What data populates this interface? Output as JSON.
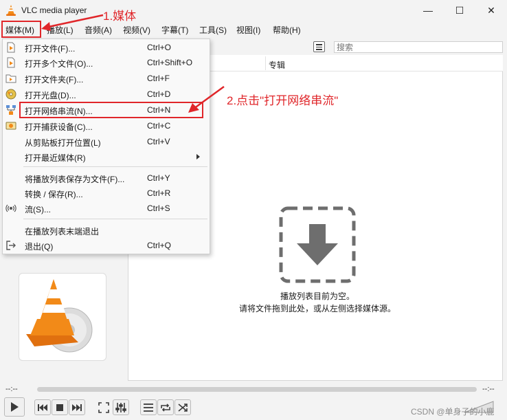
{
  "window": {
    "title": "VLC media player",
    "minimize_glyph": "—",
    "maximize_glyph": "☐",
    "close_glyph": "✕"
  },
  "menubar": {
    "items": [
      "媒体(M)",
      "播放(L)",
      "音频(A)",
      "视频(V)",
      "字幕(T)",
      "工具(S)",
      "视图(I)",
      "帮助(H)"
    ]
  },
  "annotations": {
    "step1": "1.媒体",
    "step2": "2.点击\"打开网络串流\"",
    "color": "#e0262a"
  },
  "media_menu": {
    "items": [
      {
        "label": "打开文件(F)...",
        "shortcut": "Ctrl+O",
        "icon": "file-icon"
      },
      {
        "label": "打开多个文件(O)...",
        "shortcut": "Ctrl+Shift+O",
        "icon": "files-icon"
      },
      {
        "label": "打开文件夹(F)...",
        "shortcut": "Ctrl+F",
        "icon": "folder-icon"
      },
      {
        "label": "打开光盘(D)...",
        "shortcut": "Ctrl+D",
        "icon": "disc-icon"
      },
      {
        "label": "打开网络串流(N)...",
        "shortcut": "Ctrl+N",
        "icon": "network-icon"
      },
      {
        "label": "打开捕获设备(C)...",
        "shortcut": "Ctrl+C",
        "icon": "capture-icon"
      },
      {
        "label": "从剪贴板打开位置(L)",
        "shortcut": "Ctrl+V",
        "icon": ""
      },
      {
        "label": "打开最近媒体(R)",
        "shortcut": "",
        "icon": "",
        "submenu": true
      },
      {
        "label": "将播放列表保存为文件(F)...",
        "shortcut": "Ctrl+Y",
        "icon": ""
      },
      {
        "label": "转换 / 保存(R)...",
        "shortcut": "Ctrl+R",
        "icon": ""
      },
      {
        "label": "流(S)...",
        "shortcut": "Ctrl+S",
        "icon": "stream-icon"
      },
      {
        "label": "在播放列表末端退出",
        "shortcut": "",
        "icon": ""
      },
      {
        "label": "退出(Q)",
        "shortcut": "Ctrl+Q",
        "icon": "exit-icon"
      }
    ]
  },
  "playlist": {
    "search_placeholder": "搜索",
    "column_album": "专辑",
    "empty_line1": "播放列表目前为空。",
    "empty_line2": "请将文件拖到此处，或从左侧选择媒体源。"
  },
  "seek": {
    "time_elapsed": "--:--",
    "time_total": "--:--"
  },
  "controls": [
    "play-icon",
    "previous-icon",
    "stop-icon",
    "next-icon",
    "fullscreen-icon",
    "extended-settings-icon",
    "playlist-icon",
    "loop-icon",
    "shuffle-icon"
  ],
  "watermark": "CSDN @单身子的小鹿"
}
